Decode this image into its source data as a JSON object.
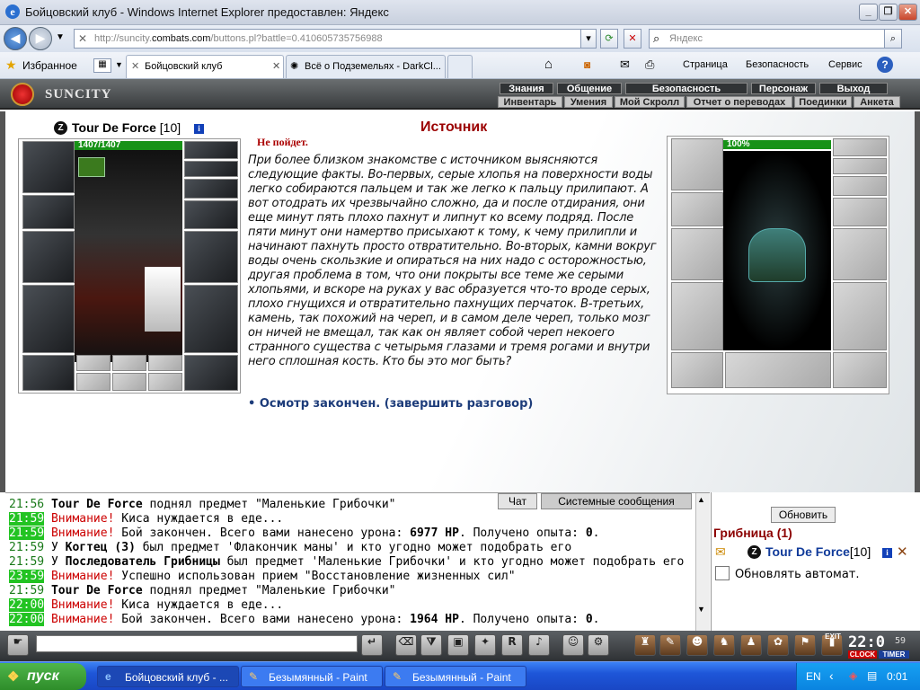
{
  "window": {
    "title": "Бойцовский клуб - Windows Internet Explorer предоставлен: Яндекс",
    "address": "http://suncity.combats.com/buttons.pl?battle=0.410605735756988",
    "address_domain": "combats.com",
    "search_placeholder": "Яндекс",
    "favorites_label": "Избранное",
    "tabs": [
      {
        "label": "Бойцовский клуб",
        "active": true
      },
      {
        "label": "Всё о Подземельях - DarkCl...",
        "active": false
      }
    ],
    "commands": [
      "Страница",
      "Безопасность",
      "Сервис"
    ]
  },
  "game": {
    "logo": "SUNCITY",
    "menu_top": [
      "Знания",
      "Общение",
      "Безопасность",
      "Персонаж",
      "Выход"
    ],
    "menu_bottom": [
      "Инвентарь",
      "Умения",
      "Мой Скролл",
      "Отчет о переводах",
      "Поединки",
      "Анкета"
    ]
  },
  "player": {
    "name": "Tour De Force",
    "level": "[10]",
    "hp": "1407/1407",
    "hp_fraction": 1.0
  },
  "dialog": {
    "heading": "Источник",
    "status": "Не пойдет.",
    "text": "При более близком знакомстве с источником выясняются следующие факты. Во-первых, серые хлопья на поверхности воды легко собираются пальцем и так же легко к пальцу прилипают. А вот отодрать их чрезвычайно сложно, да и после отдирания, они еще минут пять плохо пахнут и липнут ко всему подряд. После пяти минут они намертво присыхают к тому, к чему прилипли и начинают пахнуть просто отвратительно. Во-вторых, камни вокруг воды очень скользкие и опираться на них надо с осторожностью, другая проблема в том, что они покрыты все теме же серыми хлопьями, и вскоре на руках у вас образуется что-то вроде серых, плохо гнущихся и отвратительно пахнущих перчаток. В-третьих, камень, так похожий на череп, и в самом деле череп, только мозг он ничей не вмещал, так как он являет собой череп некоего странного существа с четырьмя глазами и тремя рогами и внутри него сплошная кость. Кто бы это мог быть?",
    "action": "Осмотр закончен. (завершить разговор)"
  },
  "opponent": {
    "hp_label": "100%",
    "hp_fraction": 1.0
  },
  "chat": {
    "tabs": [
      "Чат",
      "Системные сообщения"
    ],
    "lines": [
      {
        "time": "21:56",
        "green": false,
        "parts": [
          {
            "t": "Tour De Force",
            "s": "b"
          },
          {
            "t": " поднял предмет \"Маленькие Грибочки\"",
            "s": ""
          }
        ]
      },
      {
        "time": "21:59",
        "green": true,
        "parts": [
          {
            "t": "Внимание!",
            "s": "warn"
          },
          {
            "t": " Киса нуждается в еде...",
            "s": ""
          }
        ]
      },
      {
        "time": "21:59",
        "green": true,
        "parts": [
          {
            "t": "Внимание!",
            "s": "warn"
          },
          {
            "t": " Бой закончен. Всего вами нанесено урона: ",
            "s": ""
          },
          {
            "t": "6977 HP",
            "s": "b"
          },
          {
            "t": ". Получено опыта: ",
            "s": ""
          },
          {
            "t": "0",
            "s": "b"
          },
          {
            "t": ".",
            "s": ""
          }
        ]
      },
      {
        "time": "21:59",
        "green": false,
        "parts": [
          {
            "t": "У ",
            "s": ""
          },
          {
            "t": "Когтец (3)",
            "s": "b"
          },
          {
            "t": " был предмет 'Флакончик маны' и кто угодно может подобрать его",
            "s": ""
          }
        ]
      },
      {
        "time": "21:59",
        "green": false,
        "parts": [
          {
            "t": "У ",
            "s": ""
          },
          {
            "t": "Последователь Грибницы",
            "s": "b"
          },
          {
            "t": " был предмет 'Маленькие Грибочки' и кто угодно может подобрать его",
            "s": ""
          }
        ]
      },
      {
        "time": "23:59",
        "green": true,
        "parts": [
          {
            "t": "Внимание!",
            "s": "warn"
          },
          {
            "t": " Успешно использован прием \"Восстановление жизненных сил\"",
            "s": ""
          }
        ]
      },
      {
        "time": "21:59",
        "green": false,
        "parts": [
          {
            "t": "Tour De Force",
            "s": "b"
          },
          {
            "t": " поднял предмет \"Маленькие Грибочки\"",
            "s": ""
          }
        ]
      },
      {
        "time": "22:00",
        "green": true,
        "parts": [
          {
            "t": "Внимание!",
            "s": "warn"
          },
          {
            "t": " Киса нуждается в еде...",
            "s": ""
          }
        ]
      },
      {
        "time": "22:00",
        "green": true,
        "parts": [
          {
            "t": "Внимание!",
            "s": "warn"
          },
          {
            "t": " Бой закончен. Всего вами нанесено урона: ",
            "s": ""
          },
          {
            "t": "1964 HP",
            "s": "b"
          },
          {
            "t": ". Получено опыта: ",
            "s": ""
          },
          {
            "t": "0",
            "s": "b"
          },
          {
            "t": ".",
            "s": ""
          }
        ]
      }
    ]
  },
  "online": {
    "refresh": "Обновить",
    "room": "Грибница (1)",
    "user_name": "Tour De Force",
    "user_level": "[10]",
    "auto_refresh": "Обновлять автомат."
  },
  "toolbar": {
    "clock": "22:0",
    "seconds": "59",
    "clock_label": "CLOCK",
    "timer_label": "TIMER",
    "exit_label": "EXIT"
  },
  "taskbar": {
    "start": "пуск",
    "tasks": [
      {
        "label": "Бойцовский клуб - ...",
        "active": true
      },
      {
        "label": "Безымянный - Paint",
        "active": false
      },
      {
        "label": "Безымянный - Paint",
        "active": false
      }
    ],
    "lang": "EN",
    "time": "0:01"
  },
  "colors": {
    "heading": "#9b0000",
    "warn": "#cc0000",
    "time_green": "#22c322",
    "hp_green": "#179217"
  }
}
